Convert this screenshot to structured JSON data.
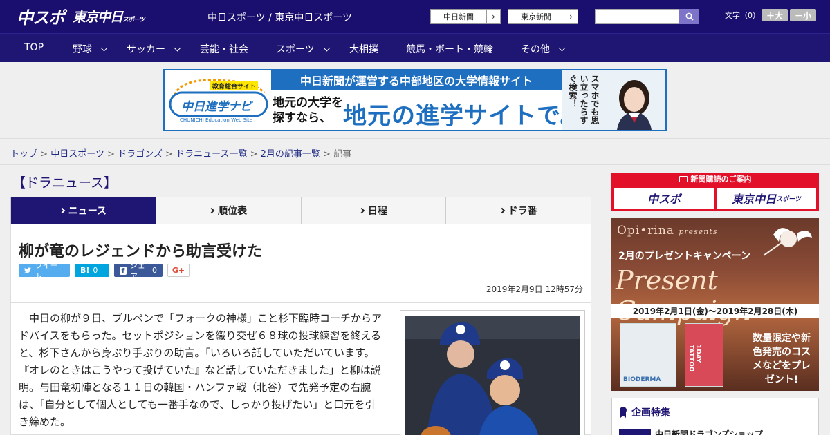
{
  "header": {
    "logo_primary": "中スポ",
    "logo_secondary": "東京中日",
    "logo_secondary_small": "スポーツ",
    "site_name": "中日スポーツ / 東京中日スポーツ",
    "ext_links": [
      {
        "label": "中日新聞"
      },
      {
        "label": "東京新聞"
      }
    ],
    "search": {
      "placeholder": "",
      "icon": "search-icon"
    },
    "font_size": {
      "label": "文字（0）",
      "larger": "＋大",
      "smaller": "－小"
    }
  },
  "nav": {
    "items": [
      {
        "label": "TOP"
      },
      {
        "label": "野球"
      },
      {
        "label": "サッカー"
      },
      {
        "label": "芸能・社会"
      },
      {
        "label": "スポーツ"
      },
      {
        "label": "大相撲"
      },
      {
        "label": "競馬・ボート・競輪"
      },
      {
        "label": "その他"
      }
    ]
  },
  "banner": {
    "badge": "教育総合サイト",
    "logo_text": "中日進学ナビ",
    "logo_sub": "CHUNICHI Education Web Site",
    "headline": "中日新聞が運営する中部地区の大学情報サイト",
    "sub_line1": "地元の大学を",
    "sub_line2": "探すなら、",
    "main": "地元の進学サイトで。",
    "vertical": "スマホでも思い立ったらすぐ検索！"
  },
  "breadcrumb": {
    "items": [
      {
        "label": "トップ"
      },
      {
        "label": "中日スポーツ"
      },
      {
        "label": "ドラゴンズ"
      },
      {
        "label": "ドラニュース一覧"
      },
      {
        "label": "2月の記事一覧"
      },
      {
        "label": "記事"
      }
    ],
    "separator": ">"
  },
  "section": {
    "title": "【ドラニュース】"
  },
  "tabs": [
    {
      "label": "ニュース"
    },
    {
      "label": "順位表"
    },
    {
      "label": "日程"
    },
    {
      "label": "ドラ番"
    }
  ],
  "article": {
    "headline": "柳が竜のレジェンドから助言受けた",
    "social": {
      "tweet": "ツイート",
      "hatena_label": "B!",
      "hatena_count": "0",
      "share": "シェア",
      "share_count": "0",
      "gplus": "G+"
    },
    "date": "2019年2月9日 12時57分",
    "body": "中日の柳が９日、ブルペンで「フォークの神様」こと杉下臨時コーチからアドバイスをもらった。セットポジションを織り交ぜ６８球の投球練習を終えると、杉下さんから身ぶり手ぶりの助言。「いろいろ話していただいています。『オレのときはこうやって投げていた』など話していただきました」と柳は説明。与田竜初陣となる１１日の韓国・ハンファ戦（北谷）で先発予定の右腕は、「自分として個人としても一番手なので、しっかり投げたい」と口元を引き締めた。"
  },
  "sidebar": {
    "subscribe": {
      "header": "新聞購読のご案内",
      "btn1": "中スポ",
      "btn2": "東京中日",
      "btn2_small": "スポーツ"
    },
    "ad": {
      "brand": "Opi•rina",
      "brand_suffix": "presents",
      "line1": "2月のプレゼントキャンペーン",
      "line2": "Present Campaign",
      "date": "2019年2月1日(金)〜2019年2月28日(木)",
      "product1_label": "BIODERMA",
      "product2_label": "1DAY TATTOO",
      "cta": "数量限定や新色発売のコスメなどをプレゼント!"
    },
    "feature": {
      "header": "企画特集",
      "item": "中日新聞ドラゴンズショップ"
    }
  },
  "colors": {
    "header_bg": "#1a0f6e",
    "nav_bg": "#1f1674",
    "accent_blue": "#1e6fc0",
    "red": "#e3102a",
    "twitter": "#55acee",
    "hatena": "#00a4de",
    "facebook": "#3b5998"
  }
}
